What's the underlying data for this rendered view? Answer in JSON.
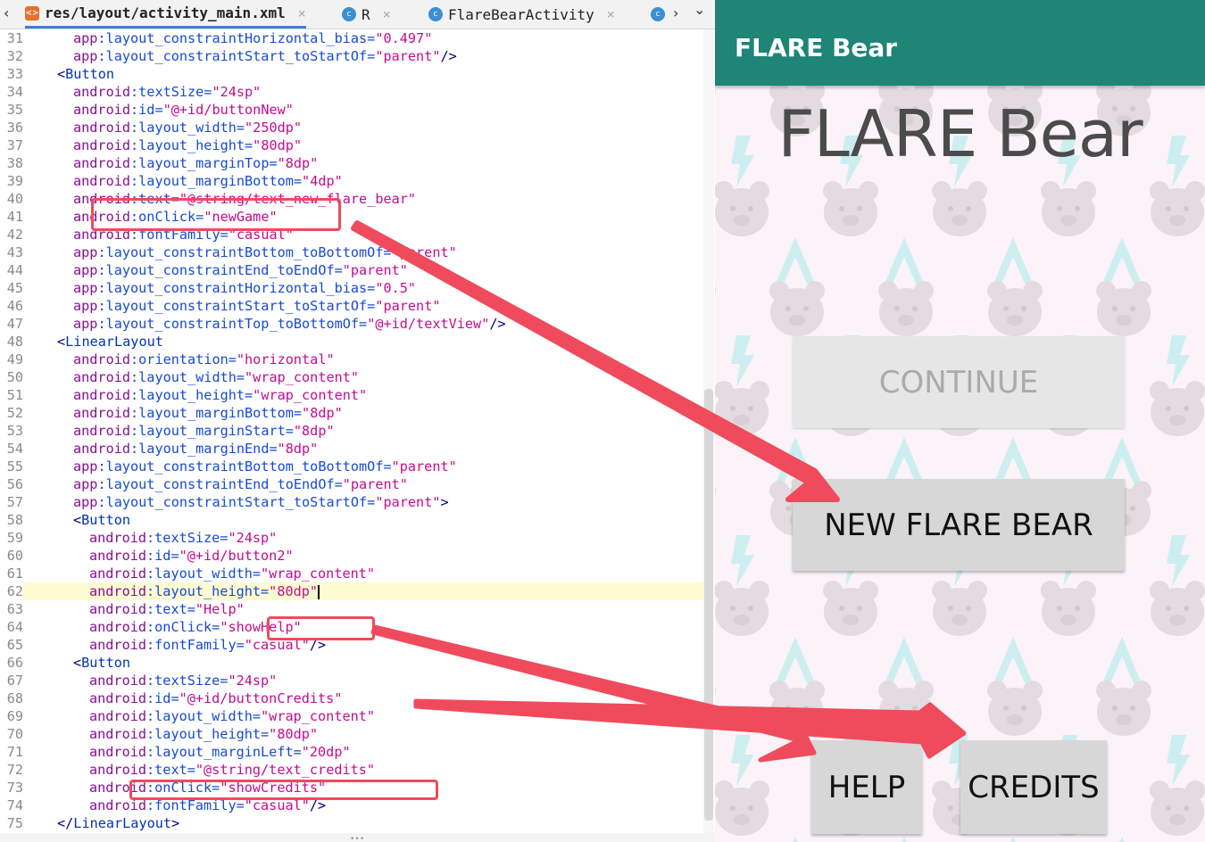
{
  "editor": {
    "tabs": [
      {
        "label": "res/layout/activity_main.xml",
        "type": "xml",
        "active": true
      },
      {
        "label": "R",
        "type": "class",
        "active": false
      },
      {
        "label": "FlareBearActivity",
        "type": "class",
        "active": false
      }
    ],
    "overflow_chevron": "›",
    "dropdown_chevron": "⌄",
    "back_chevron": "‹",
    "lines": [
      {
        "n": "31",
        "indent": 4,
        "parts": [
          [
            "ns",
            "app"
          ],
          [
            "attr",
            ":layout_constraintHorizontal_bias="
          ],
          [
            "str",
            "\"0.497\""
          ]
        ]
      },
      {
        "n": "32",
        "indent": 4,
        "parts": [
          [
            "ns",
            "app"
          ],
          [
            "attr",
            ":layout_constraintStart_toStartOf="
          ],
          [
            "str",
            "\"parent\""
          ],
          [
            "br",
            "/>"
          ]
        ]
      },
      {
        "n": "33",
        "indent": 2,
        "parts": [
          [
            "br",
            "<"
          ],
          [
            "tag",
            "Button"
          ]
        ]
      },
      {
        "n": "34",
        "indent": 4,
        "parts": [
          [
            "ns",
            "android"
          ],
          [
            "attr",
            ":textSize="
          ],
          [
            "str",
            "\"24sp\""
          ]
        ]
      },
      {
        "n": "35",
        "indent": 4,
        "parts": [
          [
            "ns",
            "android"
          ],
          [
            "attr",
            ":id="
          ],
          [
            "str",
            "\"@+id/buttonNew\""
          ]
        ]
      },
      {
        "n": "36",
        "indent": 4,
        "parts": [
          [
            "ns",
            "android"
          ],
          [
            "attr",
            ":layout_width="
          ],
          [
            "str",
            "\"250dp\""
          ]
        ]
      },
      {
        "n": "37",
        "indent": 4,
        "parts": [
          [
            "ns",
            "android"
          ],
          [
            "attr",
            ":layout_height="
          ],
          [
            "str",
            "\"80dp\""
          ]
        ]
      },
      {
        "n": "38",
        "indent": 4,
        "parts": [
          [
            "ns",
            "android"
          ],
          [
            "attr",
            ":layout_marginTop="
          ],
          [
            "str",
            "\"8dp\""
          ]
        ]
      },
      {
        "n": "39",
        "indent": 4,
        "parts": [
          [
            "ns",
            "android"
          ],
          [
            "attr",
            ":layout_marginBottom="
          ],
          [
            "str",
            "\"4dp\""
          ]
        ]
      },
      {
        "n": "40",
        "indent": 4,
        "parts": [
          [
            "ns",
            "android"
          ],
          [
            "attr",
            ":text="
          ],
          [
            "str",
            "\"@string/text_new_flare_bear\""
          ]
        ]
      },
      {
        "n": "41",
        "indent": 4,
        "parts": [
          [
            "ns",
            "android"
          ],
          [
            "attr",
            ":onClick="
          ],
          [
            "str",
            "\"newGame\""
          ]
        ]
      },
      {
        "n": "42",
        "indent": 4,
        "parts": [
          [
            "ns",
            "android"
          ],
          [
            "attr",
            ":fontFamily="
          ],
          [
            "str",
            "\"casual\""
          ]
        ]
      },
      {
        "n": "43",
        "indent": 4,
        "parts": [
          [
            "ns",
            "app"
          ],
          [
            "attr",
            ":layout_constraintBottom_toBottomOf="
          ],
          [
            "str",
            "\"parent\""
          ]
        ]
      },
      {
        "n": "44",
        "indent": 4,
        "parts": [
          [
            "ns",
            "app"
          ],
          [
            "attr",
            ":layout_constraintEnd_toEndOf="
          ],
          [
            "str",
            "\"parent\""
          ]
        ]
      },
      {
        "n": "45",
        "indent": 4,
        "parts": [
          [
            "ns",
            "app"
          ],
          [
            "attr",
            ":layout_constraintHorizontal_bias="
          ],
          [
            "str",
            "\"0.5\""
          ]
        ]
      },
      {
        "n": "46",
        "indent": 4,
        "parts": [
          [
            "ns",
            "app"
          ],
          [
            "attr",
            ":layout_constraintStart_toStartOf="
          ],
          [
            "str",
            "\"parent\""
          ]
        ]
      },
      {
        "n": "47",
        "indent": 4,
        "parts": [
          [
            "ns",
            "app"
          ],
          [
            "attr",
            ":layout_constraintTop_toBottomOf="
          ],
          [
            "str",
            "\"@+id/textView\""
          ],
          [
            "br",
            "/>"
          ]
        ]
      },
      {
        "n": "48",
        "indent": 2,
        "parts": [
          [
            "br",
            "<"
          ],
          [
            "tag",
            "LinearLayout"
          ]
        ]
      },
      {
        "n": "49",
        "indent": 4,
        "parts": [
          [
            "ns",
            "android"
          ],
          [
            "attr",
            ":orientation="
          ],
          [
            "str",
            "\"horizontal\""
          ]
        ]
      },
      {
        "n": "50",
        "indent": 4,
        "parts": [
          [
            "ns",
            "android"
          ],
          [
            "attr",
            ":layout_width="
          ],
          [
            "str",
            "\"wrap_content\""
          ]
        ]
      },
      {
        "n": "51",
        "indent": 4,
        "parts": [
          [
            "ns",
            "android"
          ],
          [
            "attr",
            ":layout_height="
          ],
          [
            "str",
            "\"wrap_content\""
          ]
        ]
      },
      {
        "n": "52",
        "indent": 4,
        "parts": [
          [
            "ns",
            "android"
          ],
          [
            "attr",
            ":layout_marginBottom="
          ],
          [
            "str",
            "\"8dp\""
          ]
        ]
      },
      {
        "n": "53",
        "indent": 4,
        "parts": [
          [
            "ns",
            "android"
          ],
          [
            "attr",
            ":layout_marginStart="
          ],
          [
            "str",
            "\"8dp\""
          ]
        ]
      },
      {
        "n": "54",
        "indent": 4,
        "parts": [
          [
            "ns",
            "android"
          ],
          [
            "attr",
            ":layout_marginEnd="
          ],
          [
            "str",
            "\"8dp\""
          ]
        ]
      },
      {
        "n": "55",
        "indent": 4,
        "parts": [
          [
            "ns",
            "app"
          ],
          [
            "attr",
            ":layout_constraintBottom_toBottomOf="
          ],
          [
            "str",
            "\"parent\""
          ]
        ]
      },
      {
        "n": "56",
        "indent": 4,
        "parts": [
          [
            "ns",
            "app"
          ],
          [
            "attr",
            ":layout_constraintEnd_toEndOf="
          ],
          [
            "str",
            "\"parent\""
          ]
        ]
      },
      {
        "n": "57",
        "indent": 4,
        "parts": [
          [
            "ns",
            "app"
          ],
          [
            "attr",
            ":layout_constraintStart_toStartOf="
          ],
          [
            "str",
            "\"parent\""
          ],
          [
            "br",
            ">"
          ]
        ]
      },
      {
        "n": "58",
        "indent": 4,
        "parts": [
          [
            "br",
            "<"
          ],
          [
            "tag",
            "Button"
          ]
        ]
      },
      {
        "n": "59",
        "indent": 6,
        "parts": [
          [
            "ns",
            "android"
          ],
          [
            "attr",
            ":textSize="
          ],
          [
            "str",
            "\"24sp\""
          ]
        ]
      },
      {
        "n": "60",
        "indent": 6,
        "parts": [
          [
            "ns",
            "android"
          ],
          [
            "attr",
            ":id="
          ],
          [
            "str",
            "\"@+id/button2\""
          ]
        ]
      },
      {
        "n": "61",
        "indent": 6,
        "parts": [
          [
            "ns",
            "android"
          ],
          [
            "attr",
            ":layout_width="
          ],
          [
            "str",
            "\"wrap_content\""
          ]
        ]
      },
      {
        "n": "62",
        "indent": 6,
        "parts": [
          [
            "ns",
            "android"
          ],
          [
            "attr",
            ":layout_height="
          ],
          [
            "str",
            "\"80dp\""
          ]
        ],
        "highlight": true,
        "caret": true
      },
      {
        "n": "63",
        "indent": 6,
        "parts": [
          [
            "ns",
            "android"
          ],
          [
            "attr",
            ":text="
          ],
          [
            "str",
            "\"Help\""
          ]
        ]
      },
      {
        "n": "64",
        "indent": 6,
        "parts": [
          [
            "ns",
            "android"
          ],
          [
            "attr",
            ":onClick="
          ],
          [
            "str",
            "\"showHelp\""
          ]
        ]
      },
      {
        "n": "65",
        "indent": 6,
        "parts": [
          [
            "ns",
            "android"
          ],
          [
            "attr",
            ":fontFamily="
          ],
          [
            "str",
            "\"casual\""
          ],
          [
            "br",
            "/>"
          ]
        ]
      },
      {
        "n": "66",
        "indent": 4,
        "parts": [
          [
            "br",
            "<"
          ],
          [
            "tag",
            "Button"
          ]
        ]
      },
      {
        "n": "67",
        "indent": 6,
        "parts": [
          [
            "ns",
            "android"
          ],
          [
            "attr",
            ":textSize="
          ],
          [
            "str",
            "\"24sp\""
          ]
        ]
      },
      {
        "n": "68",
        "indent": 6,
        "parts": [
          [
            "ns",
            "android"
          ],
          [
            "attr",
            ":id="
          ],
          [
            "str",
            "\"@+id/buttonCredits\""
          ]
        ]
      },
      {
        "n": "69",
        "indent": 6,
        "parts": [
          [
            "ns",
            "android"
          ],
          [
            "attr",
            ":layout_width="
          ],
          [
            "str",
            "\"wrap_content\""
          ]
        ]
      },
      {
        "n": "70",
        "indent": 6,
        "parts": [
          [
            "ns",
            "android"
          ],
          [
            "attr",
            ":layout_height="
          ],
          [
            "str",
            "\"80dp\""
          ]
        ]
      },
      {
        "n": "71",
        "indent": 6,
        "parts": [
          [
            "ns",
            "android"
          ],
          [
            "attr",
            ":layout_marginLeft="
          ],
          [
            "str",
            "\"20dp\""
          ]
        ]
      },
      {
        "n": "72",
        "indent": 6,
        "parts": [
          [
            "ns",
            "android"
          ],
          [
            "attr",
            ":text="
          ],
          [
            "str",
            "\"@string/text_credits\""
          ]
        ]
      },
      {
        "n": "73",
        "indent": 6,
        "parts": [
          [
            "ns",
            "android"
          ],
          [
            "attr",
            ":onClick="
          ],
          [
            "str",
            "\"showCredits\""
          ]
        ]
      },
      {
        "n": "74",
        "indent": 6,
        "parts": [
          [
            "ns",
            "android"
          ],
          [
            "attr",
            ":fontFamily="
          ],
          [
            "str",
            "\"casual\""
          ],
          [
            "br",
            "/>"
          ]
        ]
      },
      {
        "n": "75",
        "indent": 2,
        "parts": [
          [
            "br",
            "</"
          ],
          [
            "tag",
            "LinearLayout"
          ],
          [
            "br",
            ">"
          ]
        ]
      }
    ]
  },
  "phone": {
    "app_title": "FLARE Bear",
    "big_title": "FLARE Bear",
    "buttons": {
      "continue": "CONTINUE",
      "new_flare_bear": "NEW FLARE BEAR",
      "help": "HELP",
      "credits": "CREDITS"
    }
  },
  "colors": {
    "accent_teal": "#1e8577",
    "annotation_red": "#ef4b5c",
    "pattern_bear": "#e3dbe0",
    "pattern_flare": "#cdeef0"
  }
}
